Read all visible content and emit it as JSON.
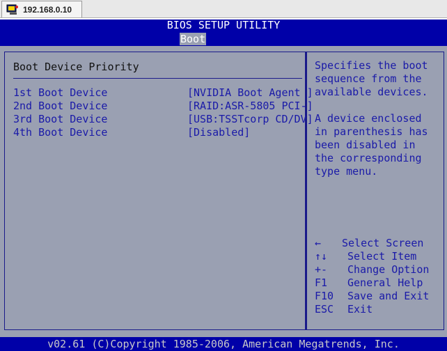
{
  "browser": {
    "tab_title": "192.168.0.10",
    "tab_icon": "kvm-console-icon"
  },
  "bios": {
    "title": "BIOS SETUP UTILITY",
    "active_menu": "Boot",
    "section_title": "Boot Device Priority",
    "rows": [
      {
        "label": "1st Boot Device",
        "value": "[NVIDIA Boot Agent ]"
      },
      {
        "label": "2nd Boot Device",
        "value": "[RAID:ASR-5805 PCI-]"
      },
      {
        "label": "3rd Boot Device",
        "value": "[USB:TSSTcorp CD/DV]"
      },
      {
        "label": "4th Boot Device",
        "value": "[Disabled]"
      }
    ],
    "help": {
      "paragraph1": "Specifies the boot sequence from the available devices.",
      "paragraph2": "A device enclosed in parenthesis has been disabled in the corresponding type menu."
    },
    "keys": [
      {
        "key": "←",
        "desc": "Select Screen"
      },
      {
        "key": "↑↓",
        "desc": "Select Item"
      },
      {
        "key": "+-",
        "desc": "Change Option"
      },
      {
        "key": "F1",
        "desc": "General Help"
      },
      {
        "key": "F10",
        "desc": "Save and Exit"
      },
      {
        "key": "ESC",
        "desc": "Exit"
      }
    ],
    "footer": "v02.61 (C)Copyright 1985-2006, American Megatrends, Inc."
  },
  "colors": {
    "bar_blue": "#0000a8",
    "panel_gray": "#9aa0b2",
    "text_blue": "#1a1aa8"
  }
}
